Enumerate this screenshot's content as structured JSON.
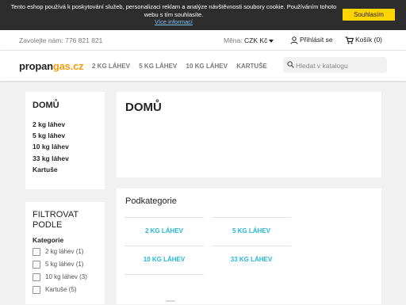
{
  "cookie": {
    "message": "Tento eshop používá k poskytování služeb, personalizaci reklam a analýze návštěvnosti soubory cookie. Používáním tohoto webu s tím souhlasíte.",
    "link": "Více informací",
    "accept": "Souhlasím"
  },
  "topbar": {
    "contact": "Zavolejte nám: 776 821 821",
    "currency_label": "Měna:",
    "currency_value": "CZK Kč",
    "login": "Přihlásit se",
    "cart": "Košík (0)"
  },
  "header": {
    "logo_part1": "propan",
    "logo_part2": "gas.cz",
    "nav": [
      "2 KG LÁHEV",
      "5 KG LÁHEV",
      "10 KG LÁHEV",
      "KARTUŠE"
    ],
    "search_placeholder": "Hledat v katalogu"
  },
  "sidebar": {
    "title": "DOMŮ",
    "items": [
      "2 kg láhev",
      "5 kg láhev",
      "10 kg láhev",
      "33 kg láhev",
      "Kartuše"
    ]
  },
  "filter": {
    "title": "FILTROVAT PODLE",
    "subtitle": "Kategorie",
    "options": [
      "2 kg láhev (1)",
      "5 kg láhev (1)",
      "10 kg láhev (3)",
      "Kartuše (5)"
    ]
  },
  "main": {
    "title": "DOMŮ",
    "subcategories_title": "Podkategorie",
    "subcategories": [
      "2 KG LÁHEV",
      "5 KG LÁHEV",
      "10 KG LÁHEV",
      "33 KG LÁHEV"
    ]
  },
  "colors": {
    "accent": "#24b9d7",
    "cookie_button": "#ffd400",
    "brand": "#f39c12"
  }
}
